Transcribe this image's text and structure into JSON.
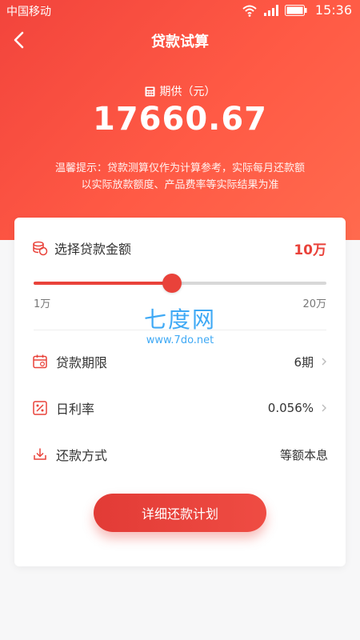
{
  "status_bar": {
    "carrier": "中国移动",
    "time": "15:36"
  },
  "nav": {
    "title": "贷款试算"
  },
  "summary": {
    "period_label": "期供（元）",
    "amount": "17660.67",
    "hint_line1": "温馨提示：贷款测算仅作为计算参考，实际每月还款额",
    "hint_line2": "以实际放款额度、产品费率等实际结果为准"
  },
  "loan_amount": {
    "label": "选择贷款金额",
    "value": "10万",
    "slider": {
      "min_label": "1万",
      "max_label": "20万",
      "min": 1,
      "max": 20,
      "current": 10
    }
  },
  "rows": {
    "term": {
      "label": "贷款期限",
      "value": "6期"
    },
    "rate": {
      "label": "日利率",
      "value": "0.056%"
    },
    "method": {
      "label": "还款方式",
      "value": "等额本息"
    }
  },
  "detail_button": {
    "label": "详细还款计划"
  },
  "watermark": {
    "main": "七度网",
    "sub": "www.7do.net"
  },
  "colors": {
    "accent": "#e9423a",
    "header_start": "#f2443c",
    "header_end": "#ff6a4e"
  }
}
